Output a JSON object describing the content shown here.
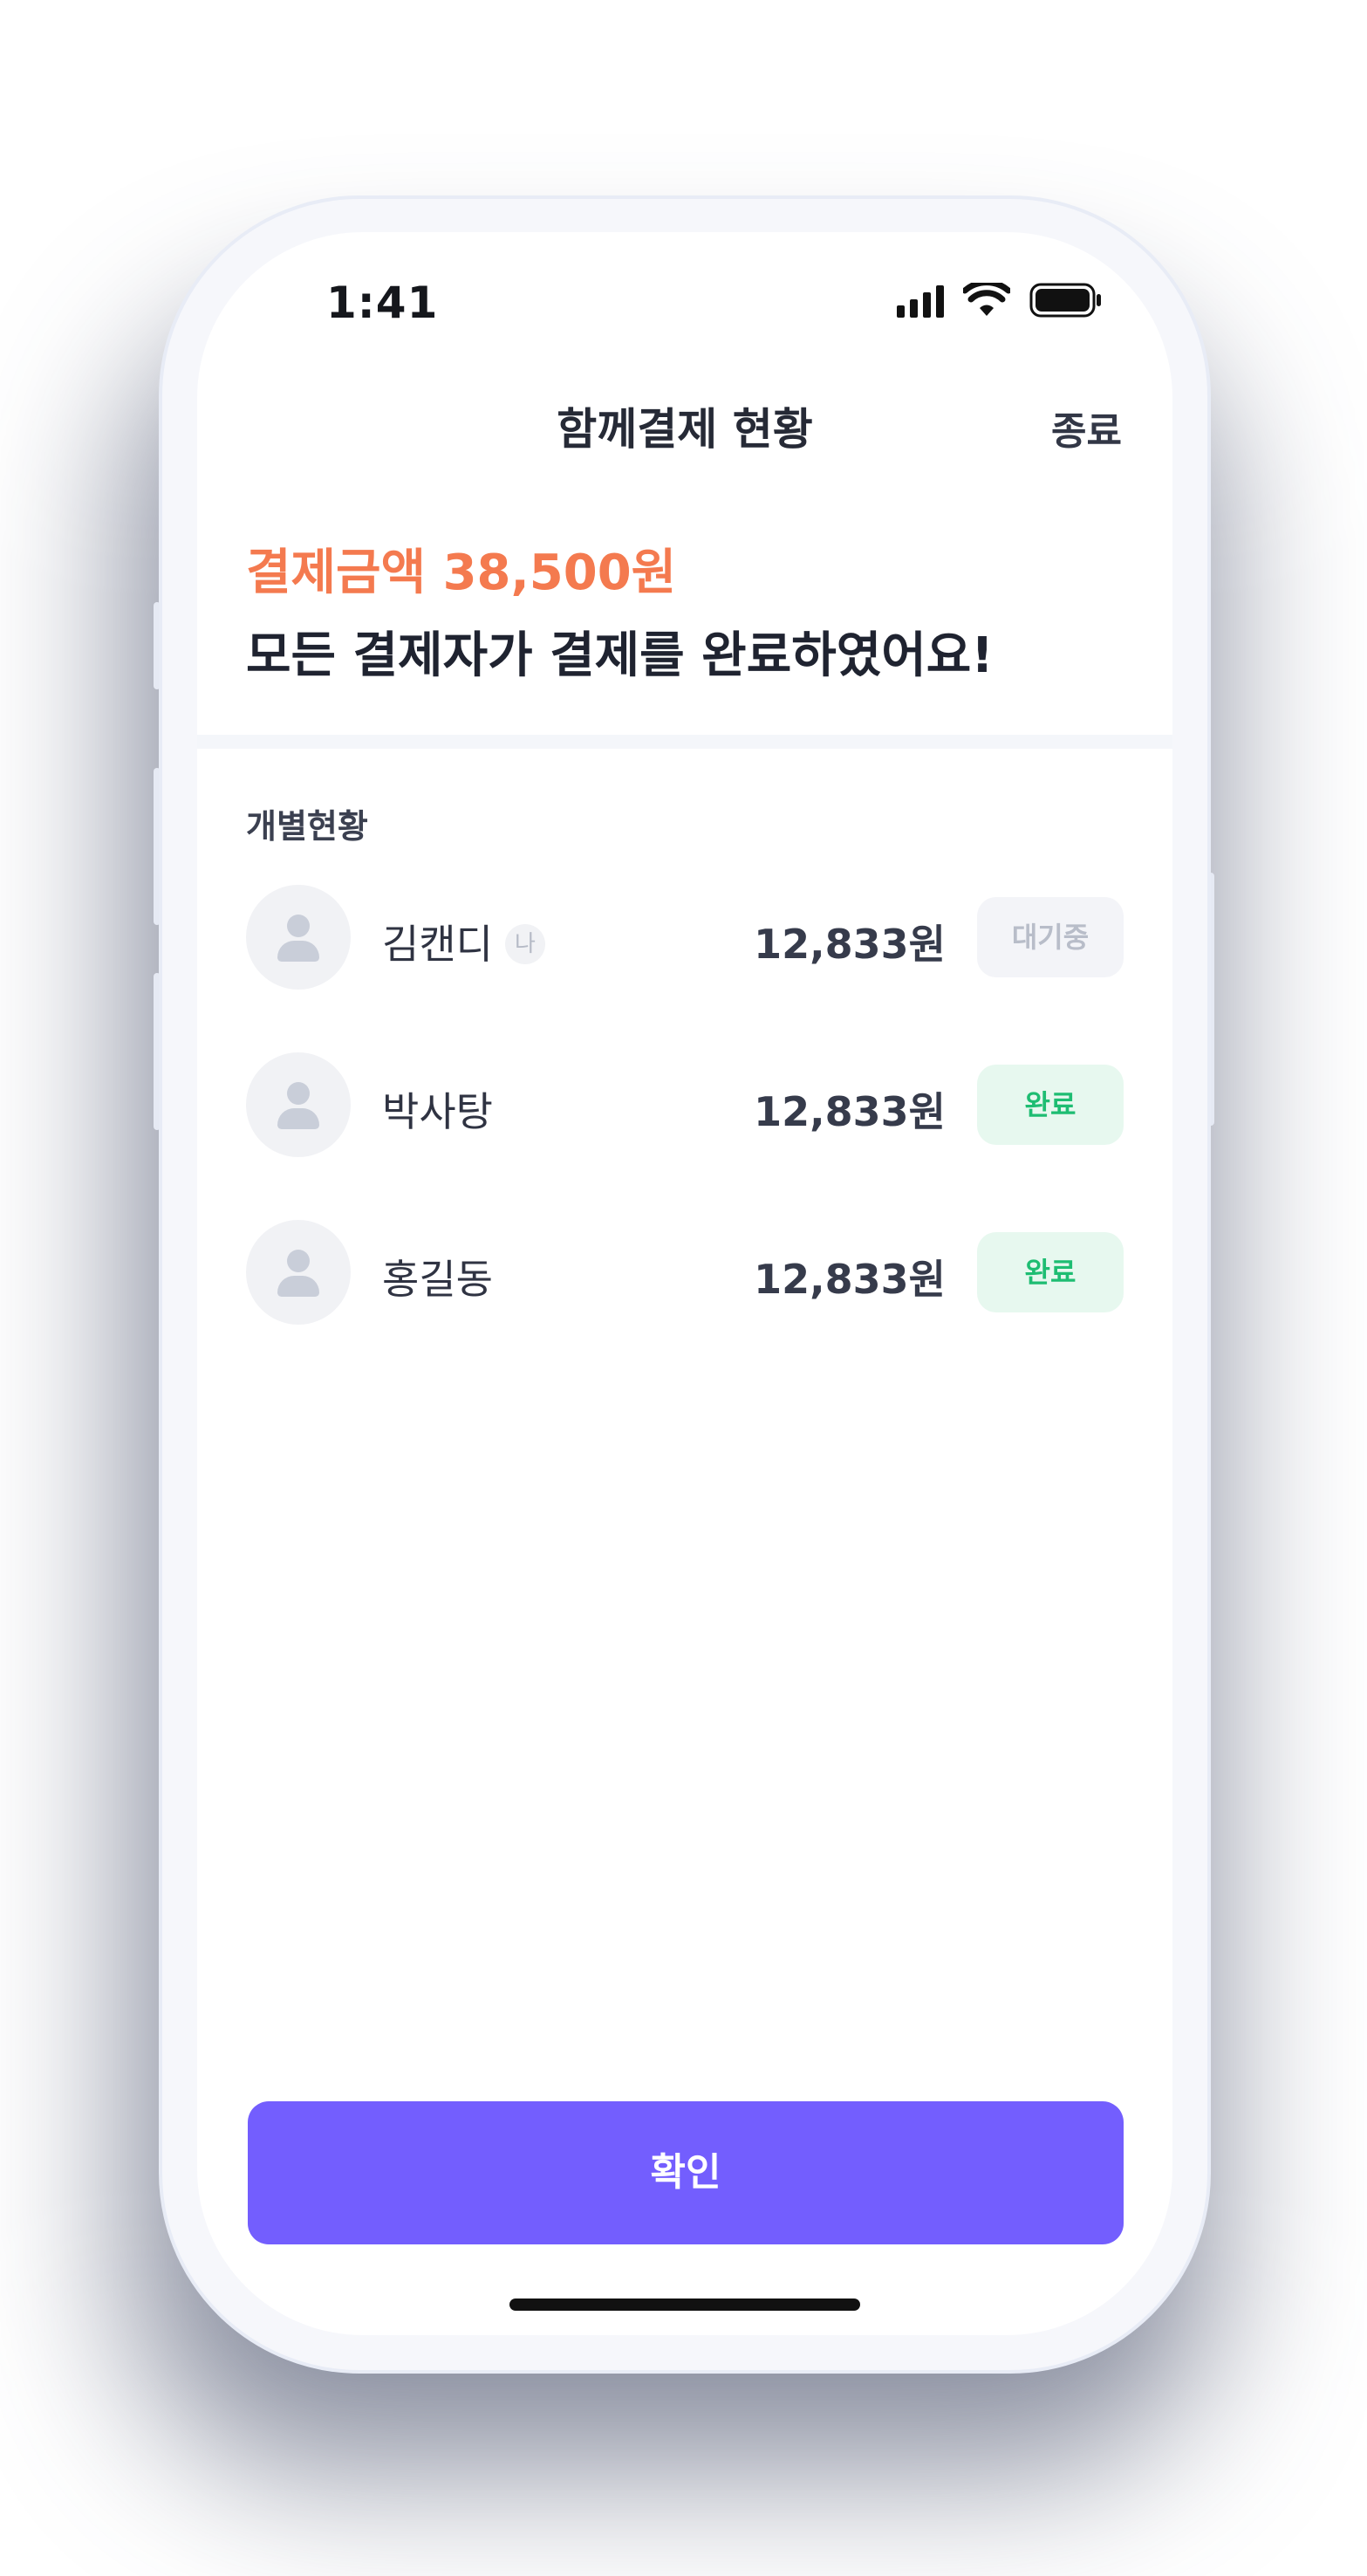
{
  "status_bar": {
    "time": "1:41",
    "signal_icon": "cellular-signal-icon",
    "wifi_icon": "wifi-icon",
    "battery_icon": "battery-icon"
  },
  "header": {
    "title": "함께결제 현황",
    "close_label": "종료"
  },
  "summary": {
    "amount_text": "결제금액 38,500원",
    "amount_color": "#f47a4f",
    "message": "모든 결제자가 결제를 완료하였어요!"
  },
  "section": {
    "title": "개별현황"
  },
  "members": [
    {
      "name": "김캔디",
      "badge": "나",
      "amount": "12,833원",
      "status": "대기중",
      "status_type": "waiting"
    },
    {
      "name": "박사탕",
      "badge": "",
      "amount": "12,833원",
      "status": "완료",
      "status_type": "done"
    },
    {
      "name": "홍길동",
      "badge": "",
      "amount": "12,833원",
      "status": "완료",
      "status_type": "done"
    }
  ],
  "confirm": {
    "label": "확인",
    "color": "#735efe"
  },
  "colors": {
    "done_text": "#1ebd72",
    "done_bg": "#e7f8ef",
    "waiting_text": "#b8bdc9",
    "waiting_bg": "#f3f4f8"
  }
}
